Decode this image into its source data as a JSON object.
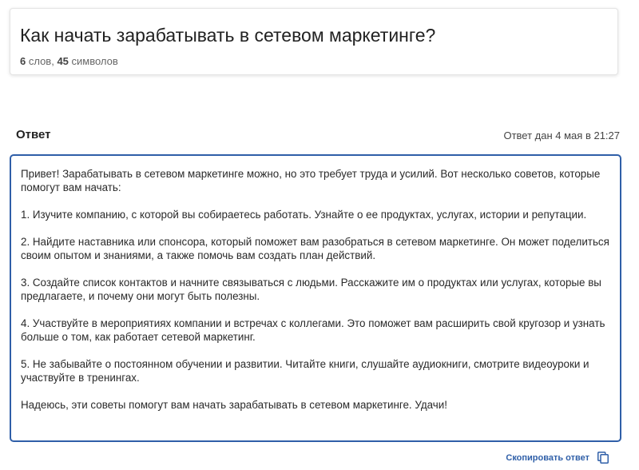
{
  "question": {
    "title": "Как начать зарабатывать в сетевом маркетинге?",
    "word_count": "6",
    "word_unit": " слов, ",
    "char_count": "45",
    "char_unit": " символов"
  },
  "answer": {
    "label": "Ответ",
    "time": "Ответ дан 4 мая в 21:27",
    "paragraphs": [
      "Привет! Зарабатывать в сетевом маркетинге можно, но это требует труда и усилий. Вот несколько советов, которые помогут вам начать:",
      "1. Изучите компанию, с которой вы собираетесь работать. Узнайте о ее продуктах, услугах, истории и репутации.",
      "2. Найдите наставника или спонсора, который поможет вам разобраться в сетевом маркетинге. Он может поделиться своим опытом и знаниями, а также помочь вам создать план действий.",
      "3. Создайте список контактов и начните связываться с людьми. Расскажите им о продуктах или услугах, которые вы предлагаете, и почему они могут быть полезны.",
      "4. Участвуйте в мероприятиях компании и встречах с коллегами. Это поможет вам расширить свой кругозор и узнать больше о том, как работает сетевой маркетинг.",
      "5. Не забывайте о постоянном обучении и развитии. Читайте книги, слушайте аудиокниги, смотрите видеоуроки и участвуйте в тренингах.",
      "Надеюсь, эти советы помогут вам начать зарабатывать в сетевом маркетинге. Удачи!"
    ],
    "copy_label": "Скопировать ответ",
    "copy_icon": "copy-icon"
  },
  "colors": {
    "accent": "#2f5fa8",
    "text": "#2a2a2a"
  }
}
